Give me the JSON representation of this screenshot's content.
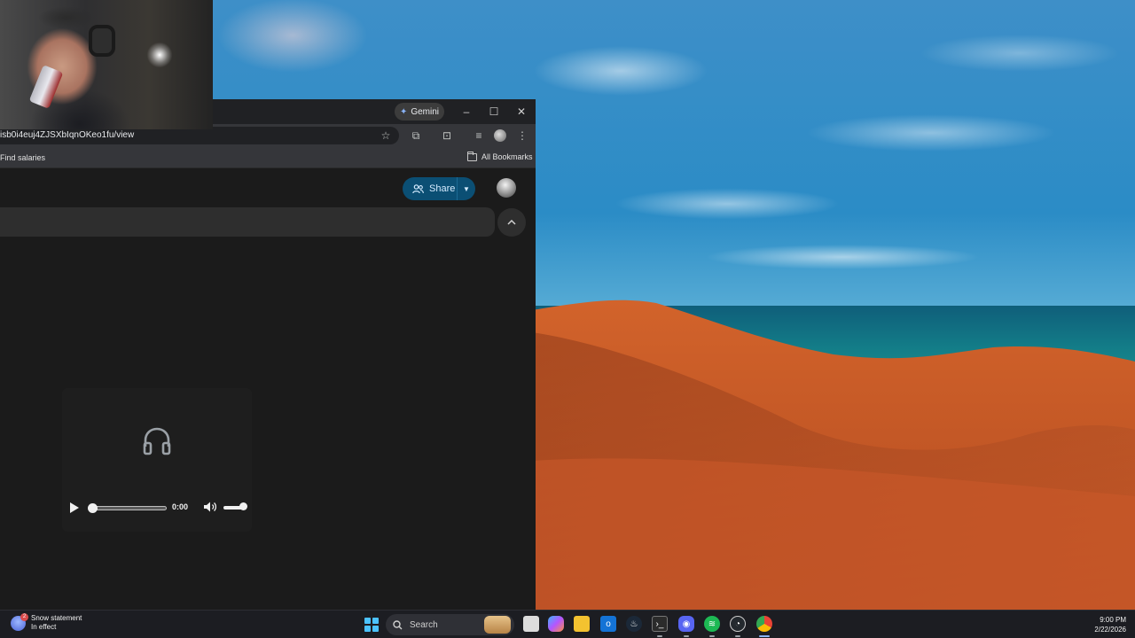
{
  "browser": {
    "gemini_label": "Gemini",
    "url_fragment": "isb0i4euj4ZJSXbIqnOKeo1fu/view",
    "bookmark_left": "Find salaries",
    "all_bookmarks": "All Bookmarks",
    "window_controls": {
      "minimize": "–",
      "maximize": "☐",
      "close": "✕"
    }
  },
  "drive": {
    "share_label": "Share",
    "collapse_icon": "chevron-up"
  },
  "player": {
    "time": "0:00",
    "seek_progress": 0,
    "volume_level": 1.0
  },
  "taskbar": {
    "weather_title": "Snow statement",
    "weather_subtitle": "In effect",
    "weather_badge": "2",
    "search_placeholder": "Search",
    "time": "9:00 PM",
    "date": "2/22/2026",
    "apps": [
      "start-icon",
      "task-view-icon",
      "copilot-icon",
      "file-explorer-icon",
      "outlook-icon",
      "steam-icon",
      "terminal-icon",
      "discord-icon",
      "spotify-icon",
      "github-icon",
      "chrome-icon"
    ]
  },
  "colors": {
    "share_bg": "#0b4f74",
    "start_blue": "#4cc2ff",
    "page_bg": "#1b1b1b"
  }
}
